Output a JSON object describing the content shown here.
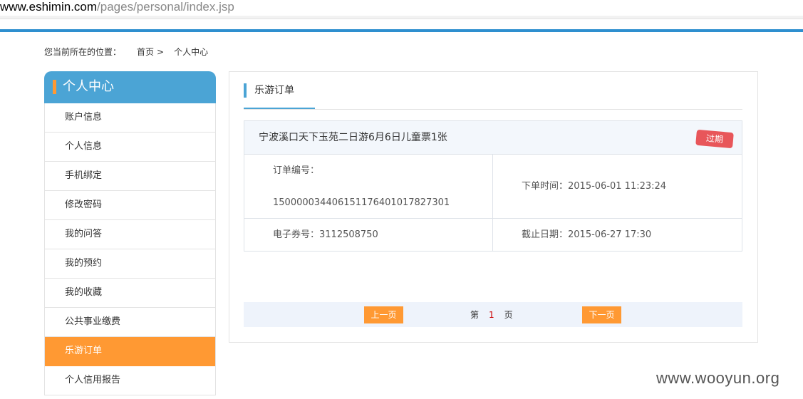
{
  "browser": {
    "url_host": "www.eshimin.com",
    "url_path": "/pages/personal/index.jsp"
  },
  "breadcrumb": {
    "prefix": "您当前所在的位置：",
    "home": "首页",
    "separator": ">",
    "current": "个人中心"
  },
  "sidebar": {
    "title": "个人中心",
    "items": [
      {
        "label": "账户信息"
      },
      {
        "label": "个人信息"
      },
      {
        "label": "手机绑定"
      },
      {
        "label": "修改密码"
      },
      {
        "label": "我的问答"
      },
      {
        "label": "我的预约"
      },
      {
        "label": "我的收藏"
      },
      {
        "label": "公共事业缴费"
      },
      {
        "label": "乐游订单",
        "active": true
      },
      {
        "label": "个人信用报告"
      }
    ],
    "accent_color": "#ff9933",
    "header_color": "#4ba4d5"
  },
  "panel": {
    "title": "乐游订单",
    "order": {
      "name": "宁波溪口天下玉苑二日游6月6日儿童票1张",
      "status": "过期",
      "order_no_label": "订单编号：",
      "order_no": "150000034406151176401017827301",
      "order_time": "下单时间：2015-06-01 11:23:24",
      "voucher": "电子券号：3112508750",
      "deadline": "截止日期：2015-06-27 17:30"
    },
    "pager": {
      "prev": "上一页",
      "page_prefix": "第",
      "page_number": "1",
      "page_suffix": "页",
      "next": "下一页"
    }
  },
  "watermark": "www.wooyun.org"
}
